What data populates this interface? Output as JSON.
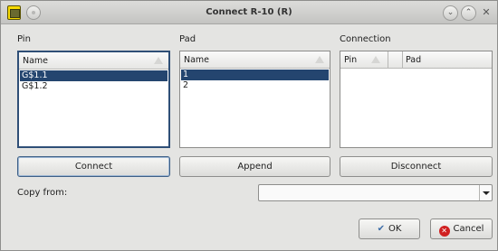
{
  "window": {
    "title": "Connect R-10 (R)"
  },
  "labels": {
    "pin": "Pin",
    "pad": "Pad",
    "connection": "Connection",
    "copy_from": "Copy from:"
  },
  "pin_list": {
    "header": "Name",
    "items": [
      "G$1.1",
      "G$1.2"
    ],
    "selected": "G$1.1"
  },
  "pad_list": {
    "header": "Name",
    "items": [
      "1",
      "2"
    ],
    "selected": "1"
  },
  "connection_list": {
    "headers": [
      "Pin",
      "Pad"
    ],
    "rows": []
  },
  "buttons": {
    "connect": "Connect",
    "append": "Append",
    "disconnect": "Disconnect",
    "ok": "OK",
    "cancel": "Cancel"
  },
  "copy_from": {
    "value": ""
  },
  "icons": {
    "app": "eagle-app-icon",
    "menu": "window-menu-icon",
    "minimize": "chevron-down-icon",
    "maximize": "chevron-up-icon",
    "close": "close-icon",
    "ok": "checkmark-icon",
    "cancel": "cancel-icon"
  },
  "colors": {
    "selection": "#24456f",
    "focus_border": "#2f4f77"
  }
}
